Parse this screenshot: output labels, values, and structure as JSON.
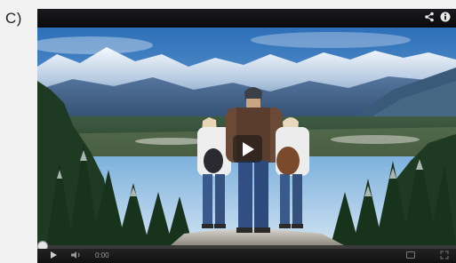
{
  "figure": {
    "label": "C)"
  },
  "player": {
    "icons": {
      "share": "share-icon",
      "info": "info-icon",
      "play_overlay": "play-icon",
      "play": "play-icon",
      "volume": "volume-icon",
      "captions": "captions-icon",
      "fullscreen": "fullscreen-icon"
    },
    "progress": 0.01,
    "time": "0:00",
    "quality": "",
    "colors": {
      "chrome": "#0d0d0f",
      "progress_fill": "#aaaaaa",
      "icon": "#cfcfcf"
    }
  }
}
